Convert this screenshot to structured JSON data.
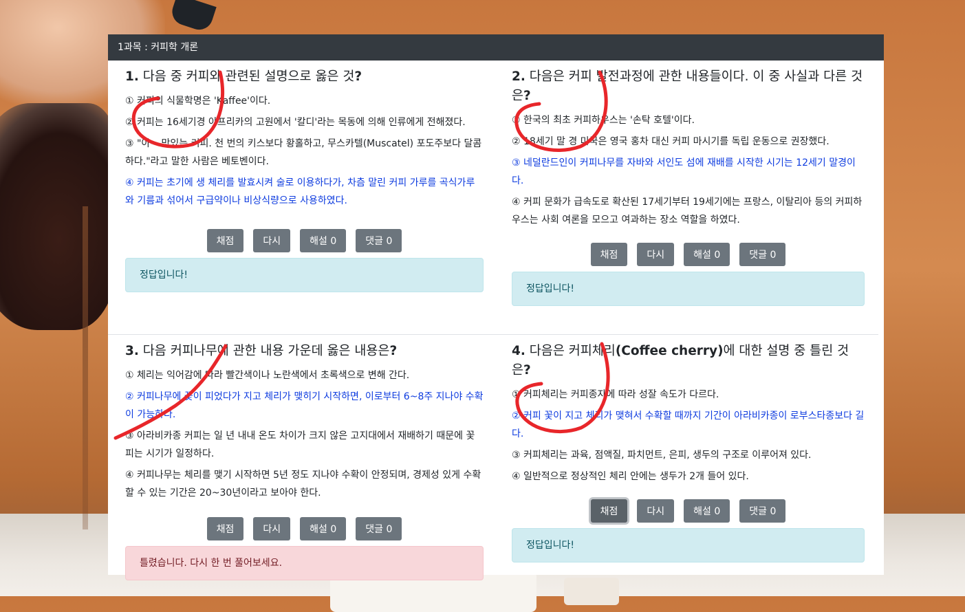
{
  "header": {
    "title": "1과목 : 커피학 개론"
  },
  "buttons": {
    "grade": "채점",
    "retry": "다시"
  },
  "questions": [
    {
      "num": "1.",
      "title": " 다음 중 커피와 관련된 설명으로 옳은 것",
      "mark": "?",
      "choices": [
        "① 커피의 식물학명은 'Kaffee'이다.",
        "② 커피는 16세기경 아프리카의 고원에서 '칼디'라는 목동에 의해 인류에게 전해졌다.",
        "③ \"아~ 맛있는 커피. 천 번의 키스보다 황홀하고, 무스카텔(Muscatel) 포도주보다 달콤하다.\"라고 말한 사람은 베토벤이다.",
        "④ 커피는 초기에 생 체리를 발효시켜 술로 이용하다가, 차츰 말린 커피 가루를 곡식가루와 기름과 섞어서 구급약이나 비상식량으로 사용하였다."
      ],
      "correct_index": 3,
      "explain": "해설 0",
      "comments": "댓글 0",
      "result": "정답입니다!",
      "result_type": "ok"
    },
    {
      "num": "2.",
      "title": " 다음은 커피 발전과정에 관한 내용들이다. 이 중 사실과 다른 것은",
      "mark": "?",
      "choices": [
        "① 한국의 최초 커피하우스는 '손탁 호텔'이다.",
        "② 18세기 말 경 미국은 영국 홍차 대신 커피 마시기를 독립 운동으로 권장했다.",
        "③ 네덜란드인이 커피나무를 자바와 서인도 섬에 재배를 시작한 시기는 12세기 말경이다.",
        "④ 커피 문화가 급속도로 확산된 17세기부터 19세기에는 프랑스, 이탈리아 등의 커피하우스는 사회 여론을 모으고 여과하는 장소 역할을 하였다."
      ],
      "correct_index": 2,
      "explain": "해설 0",
      "comments": "댓글 0",
      "result": "정답입니다!",
      "result_type": "ok"
    },
    {
      "num": "3.",
      "title": " 다음 커피나무에 관한 내용 가운데 옳은 내용은",
      "mark": "?",
      "choices": [
        "① 체리는 익어감에 따라 빨간색이나 노란색에서 초록색으로 변해 간다.",
        "② 커피나무에 꽃이 피었다가 지고 체리가 맺히기 시작하면, 이로부터 6~8주 지나야 수확이 가능하다.",
        "③ 아라비카종 커피는 일 년 내내 온도 차이가 크지 않은 고지대에서 재배하기 때문에 꽃피는 시기가 일정하다.",
        "④ 커피나무는 체리를 맺기 시작하면 5년 정도 지나야 수확이 안정되며, 경제성 있게 수확할 수 있는 기간은 20~30년이라고 보아야 한다."
      ],
      "correct_index": 1,
      "explain": "해설 0",
      "comments": "댓글 0",
      "result": "틀렸습니다. 다시 한 번 풀어보세요.",
      "result_type": "bad"
    },
    {
      "num": "4.",
      "title_pre": " 다음은 커피체리",
      "title_bold": "(Coffee cherry)",
      "title_post": "에 대한 설명 중 틀린 것은",
      "mark": "?",
      "choices": [
        "① 커피체리는 커피종자에 따라 성잘 속도가 다르다.",
        "② 커피 꽃이 지고 체리가 맺혀서 수확할 때까지 기간이 아라비카종이 로부스타종보다 길다.",
        "③ 커피체리는 과육, 점액질, 파치먼트, 은피, 생두의 구조로 이루어져 있다.",
        "④ 일반적으로 정상적인 체리 안에는 생두가 2개 들어 있다."
      ],
      "correct_index": 1,
      "explain": "해설 0",
      "comments": "댓글 0",
      "result": "정답입니다!",
      "result_type": "ok"
    }
  ]
}
